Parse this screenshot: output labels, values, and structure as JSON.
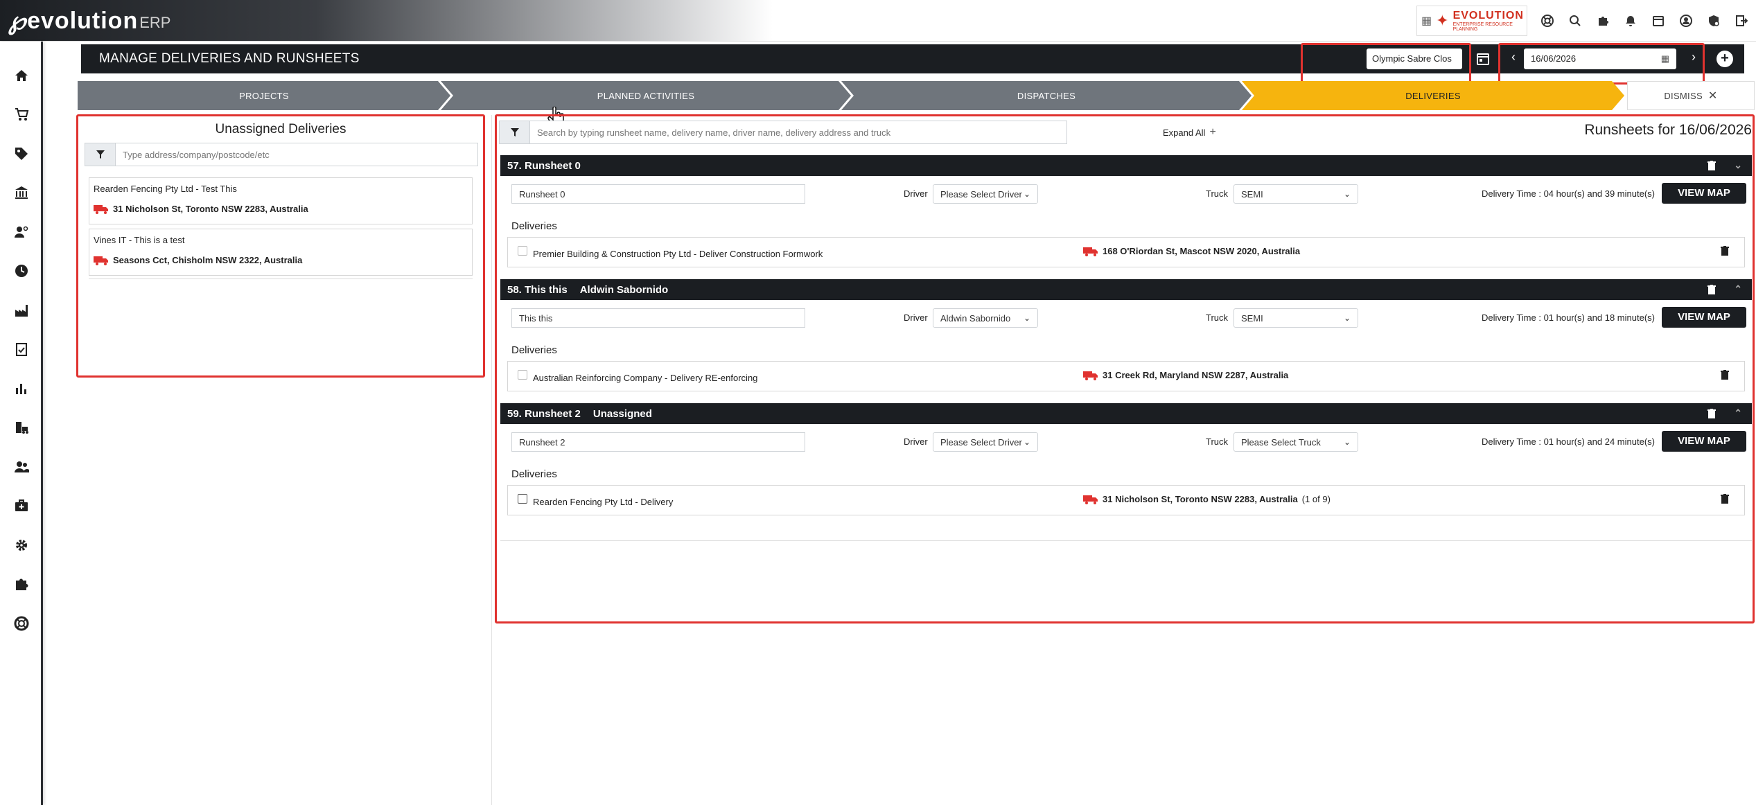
{
  "app": {
    "logo_text": "evolution",
    "logo_suffix": "ERP"
  },
  "org_logo": {
    "name": "EVOLUTION",
    "tagline": "ENTERPRISE RESOURCE PLANNING"
  },
  "header": {
    "title": "MANAGE DELIVERIES AND RUNSHEETS",
    "location": "Olympic Sabre Clos",
    "date": "16/06/2026"
  },
  "stepper": [
    {
      "label": "PROJECTS"
    },
    {
      "label": "PLANNED ACTIVITIES"
    },
    {
      "label": "DISPATCHES"
    },
    {
      "label": "DELIVERIES"
    },
    {
      "label": "DISMISS"
    }
  ],
  "unassigned": {
    "title": "Unassigned Deliveries",
    "placeholder": "Type address/company/postcode/etc",
    "items": [
      {
        "title": "Rearden Fencing Pty Ltd - Test This",
        "address": "31 Nicholson St, Toronto NSW 2283, Australia"
      },
      {
        "title": "Vines IT - This is a test",
        "address": "Seasons Cct, Chisholm NSW 2322, Australia"
      }
    ]
  },
  "runsheets": {
    "search_placeholder": "Search by typing runsheet name, delivery name, driver name, delivery address and truck",
    "expand_all": "Expand All",
    "title": "Runsheets for 16/06/2026",
    "driver_label": "Driver",
    "truck_label": "Truck",
    "deliveries_label": "Deliveries",
    "view_map": "VIEW MAP",
    "items": [
      {
        "header": "57. Runsheet 0",
        "header_driver": "",
        "name": "Runsheet 0",
        "driver": "Please Select Driver",
        "truck": "SEMI",
        "delivery_time": "Delivery Time : 04 hour(s) and 39 minute(s)",
        "delivery": {
          "name": "Premier Building & Construction Pty Ltd - Deliver Construction Formwork",
          "address": "168 O'Riordan St, Mascot NSW 2020, Australia",
          "count": ""
        }
      },
      {
        "header": "58. This this",
        "header_driver": "Aldwin Sabornido",
        "name": "This this",
        "driver": "Aldwin Sabornido",
        "truck": "SEMI",
        "delivery_time": "Delivery Time : 01 hour(s) and 18 minute(s)",
        "delivery": {
          "name": "Australian Reinforcing Company - Delivery RE-enforcing",
          "address": "31 Creek Rd, Maryland NSW 2287, Australia",
          "count": ""
        }
      },
      {
        "header": "59. Runsheet 2",
        "header_driver": "Unassigned",
        "name": "Runsheet 2",
        "driver": "Please Select Driver",
        "truck": "Please Select Truck",
        "delivery_time": "Delivery Time : 01 hour(s) and 24 minute(s)",
        "delivery": {
          "name": "Rearden Fencing Pty Ltd - Delivery",
          "address": "31 Nicholson St, Toronto NSW 2283, Australia",
          "count": "(1 of 9)"
        }
      }
    ]
  },
  "colors": {
    "dark": "#1b1e22",
    "step_gray": "#6f757c",
    "step_active": "#f6b40e",
    "highlight": "#e0322f",
    "truck": "#e0322f"
  }
}
